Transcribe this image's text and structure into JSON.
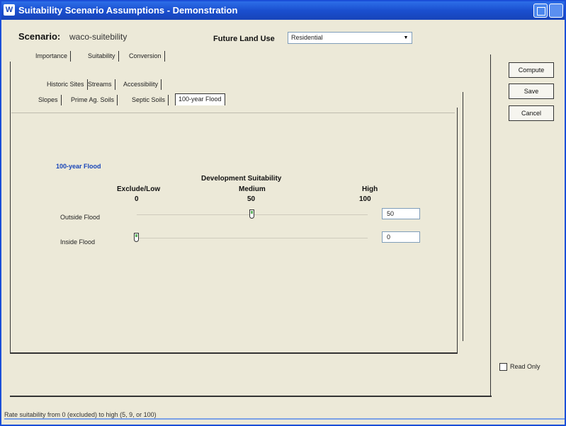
{
  "window": {
    "app_icon": "app-icon",
    "title": "Suitability Scenario Assumptions - Demonstration",
    "buttons": [
      "restore-icon",
      "close-icon"
    ]
  },
  "header": {
    "scenario_label": "Scenario:",
    "scenario_value": "waco-suitebility",
    "future_land_use_label": "Future Land Use",
    "future_land_use_value": "Residential"
  },
  "main_tabs": [
    "Importance",
    "Suitability",
    "Conversion"
  ],
  "sub_tabs_row1": [
    "Historic Sites",
    "Streams",
    "Accessibility"
  ],
  "sub_tabs_row2": [
    "Slopes",
    "Prime Ag. Soils",
    "Septic Soils",
    "100-year Flood"
  ],
  "active_sub_tab": "100-year Flood",
  "buttons": {
    "compute": "Compute",
    "save": "Save",
    "cancel": "Cancel"
  },
  "flood": {
    "title": "100-year Flood",
    "heading": "Development Suitability",
    "scale": [
      {
        "label": "Exclude/Low",
        "value": "0"
      },
      {
        "label": "Medium",
        "value": "50"
      },
      {
        "label": "High",
        "value": "100"
      }
    ],
    "rows": [
      {
        "label": "Outside Flood",
        "value": "50",
        "level": 50
      },
      {
        "label": "Inside Flood",
        "value": "0",
        "level": 0
      }
    ]
  },
  "read_only_label": "Read Only",
  "status": "Rate suitability from 0 (excluded) to high (5, 9, or 100)",
  "colors": {
    "title_bar": "#1a4fcf",
    "accent": "#1744b9",
    "thumb": "#5fb35f"
  }
}
